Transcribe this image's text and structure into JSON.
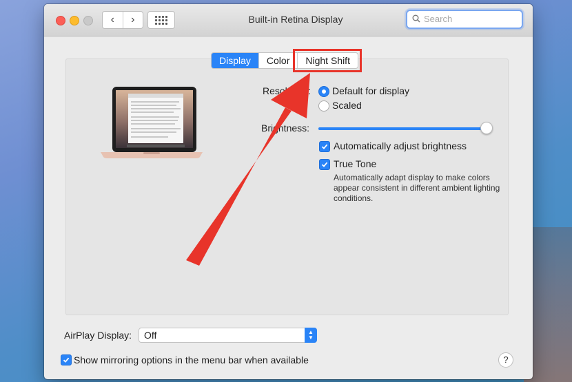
{
  "window": {
    "title": "Built-in Retina Display"
  },
  "toolbar": {
    "back": "‹",
    "forward": "›"
  },
  "search": {
    "placeholder": "Search"
  },
  "tabs": [
    {
      "label": "Display",
      "selected": true
    },
    {
      "label": "Color",
      "selected": false
    },
    {
      "label": "Night Shift",
      "selected": false,
      "highlighted": true
    }
  ],
  "display": {
    "resolution_label": "Resolution:",
    "resolution_options": [
      {
        "label": "Default for display",
        "selected": true
      },
      {
        "label": "Scaled",
        "selected": false
      }
    ],
    "brightness_label": "Brightness:",
    "brightness_level": 0.99,
    "auto_brightness": {
      "label": "Automatically adjust brightness",
      "checked": true
    },
    "true_tone": {
      "label": "True Tone",
      "checked": true
    },
    "true_tone_description": "Automatically adapt display to make colors appear consistent in different ambient lighting conditions."
  },
  "airplay": {
    "label": "AirPlay Display:",
    "value": "Off"
  },
  "mirroring": {
    "label": "Show mirroring options in the menu bar when available",
    "checked": true
  },
  "help": {
    "label": "?"
  },
  "colors": {
    "accent": "#2a84f7",
    "annotation": "#e8342a"
  }
}
